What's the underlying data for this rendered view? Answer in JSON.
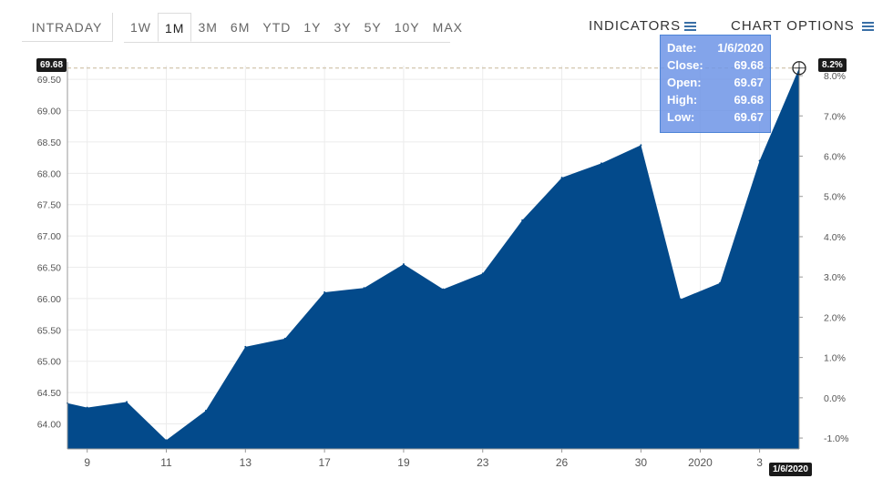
{
  "toolbar": {
    "intraday": "INTRADAY",
    "ranges": [
      "1W",
      "1M",
      "3M",
      "6M",
      "YTD",
      "1Y",
      "3Y",
      "5Y",
      "10Y",
      "MAX"
    ],
    "active_range": "1M",
    "indicators": "INDICATORS",
    "chart_options": "CHART OPTIONS"
  },
  "tooltip": {
    "date_label": "Date:",
    "date_value": "1/6/2020",
    "close_label": "Close:",
    "close_value": "69.68",
    "open_label": "Open:",
    "open_value": "69.67",
    "high_label": "High:",
    "high_value": "69.68",
    "low_label": "Low:",
    "low_value": "69.67"
  },
  "badges": {
    "price": "69.68",
    "pct": "8.2%",
    "date": "1/6/2020"
  },
  "colors": {
    "fill": "#034a8b",
    "grid": "#ececec",
    "accent": "#3a6fa6"
  },
  "chart_data": {
    "type": "area",
    "title": "",
    "xlabel": "",
    "ylabel": "",
    "x_ticks": [
      "9",
      "11",
      "13",
      "17",
      "19",
      "23",
      "26",
      "30",
      "2020",
      "3"
    ],
    "x_tick_index": [
      1,
      5,
      9,
      13,
      17,
      21,
      25,
      29,
      32,
      35
    ],
    "y_ticks": [
      "64.00",
      "64.50",
      "65.00",
      "65.50",
      "66.00",
      "66.50",
      "67.00",
      "67.50",
      "68.00",
      "68.50",
      "69.00",
      "69.50"
    ],
    "y2_ticks": [
      "-1.0%",
      "0.0%",
      "1.0%",
      "2.0%",
      "3.0%",
      "4.0%",
      "5.0%",
      "6.0%",
      "7.0%",
      "8.0%"
    ],
    "ylim": [
      63.6,
      69.72
    ],
    "y2lim": [
      -1.27,
      8.25
    ],
    "grid": true,
    "series": [
      {
        "values": [
          64.33,
          64.26,
          64.35,
          63.74,
          64.21,
          65.23,
          65.36,
          66.1,
          66.17,
          66.55,
          66.15,
          66.4,
          67.25,
          67.93,
          68.16,
          68.45,
          65.99,
          66.25,
          68.2,
          69.68
        ],
        "x_index": [
          0,
          1,
          3,
          5,
          7,
          9,
          11,
          13,
          15,
          17,
          19,
          21,
          23,
          25,
          27,
          29,
          31,
          33,
          35,
          37
        ]
      }
    ]
  }
}
